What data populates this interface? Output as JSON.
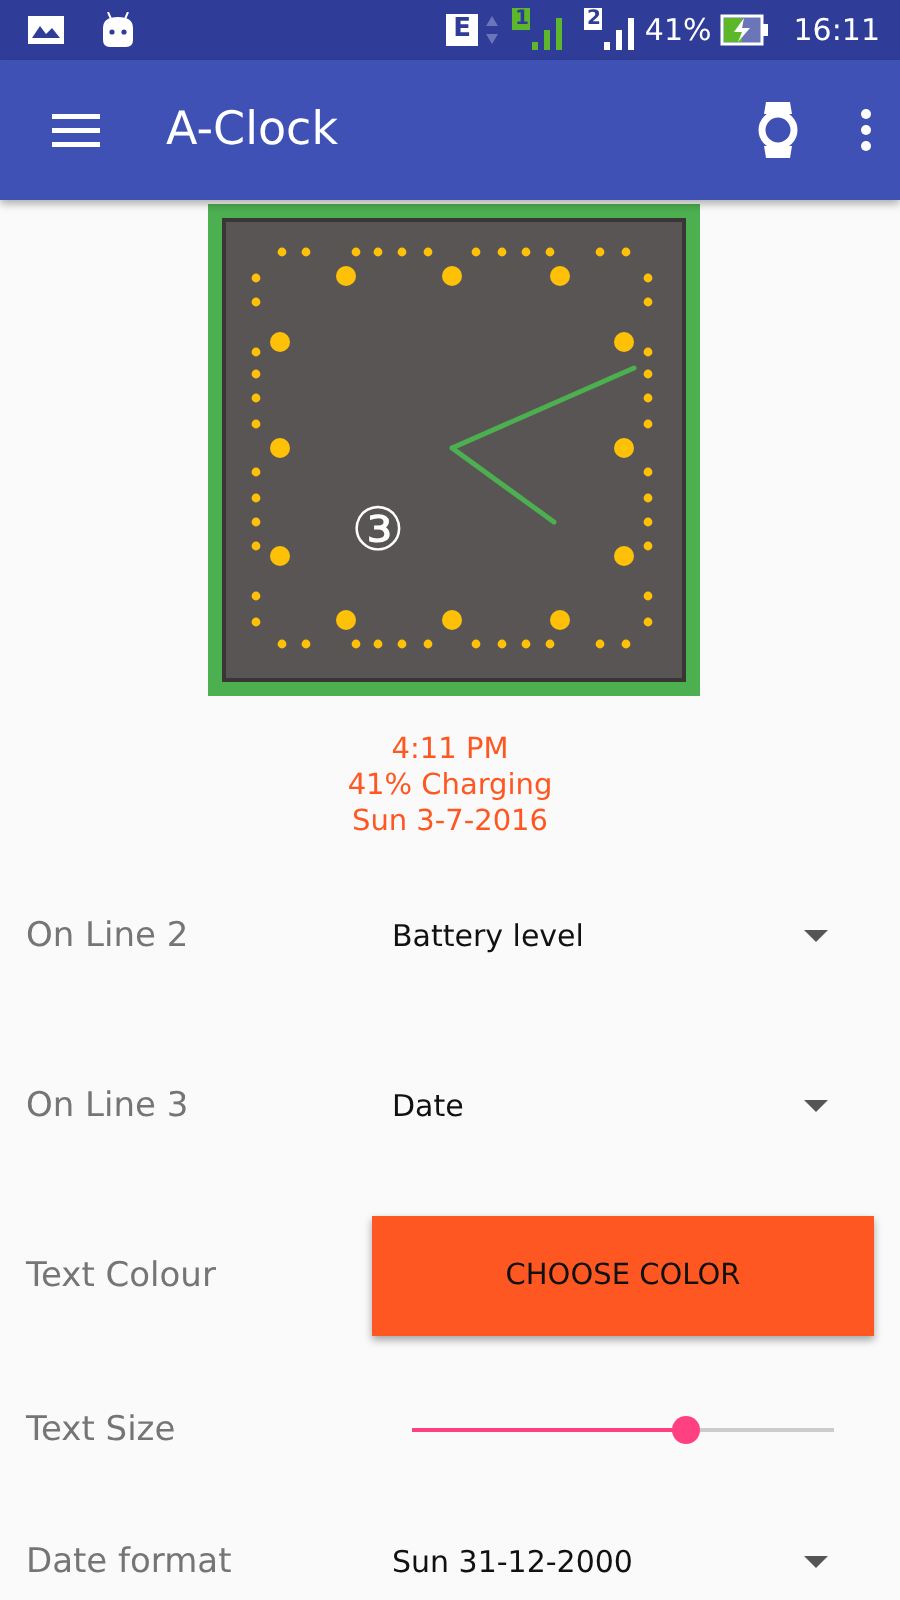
{
  "status_bar": {
    "network_type": "E",
    "sim_1": "1",
    "sim_2": "2",
    "battery_percent": "41%",
    "time": "16:11"
  },
  "app_bar": {
    "title": "A-Clock"
  },
  "clock": {
    "complication": "③"
  },
  "preview_lines": [
    "4:11 PM",
    "41% Charging",
    "Sun 3-7-2016"
  ],
  "settings": [
    {
      "kind": "dropdown",
      "label": "On Line 2",
      "value": "Battery level"
    },
    {
      "kind": "dropdown",
      "label": "On Line 3",
      "value": "Date"
    },
    {
      "kind": "button",
      "label": "Text Colour",
      "value": "CHOOSE COLOR"
    },
    {
      "kind": "slider",
      "label": "Text Size",
      "level": 0.65
    },
    {
      "kind": "dropdown",
      "label": "Date format",
      "value": "Sun 31-12-2000"
    }
  ]
}
